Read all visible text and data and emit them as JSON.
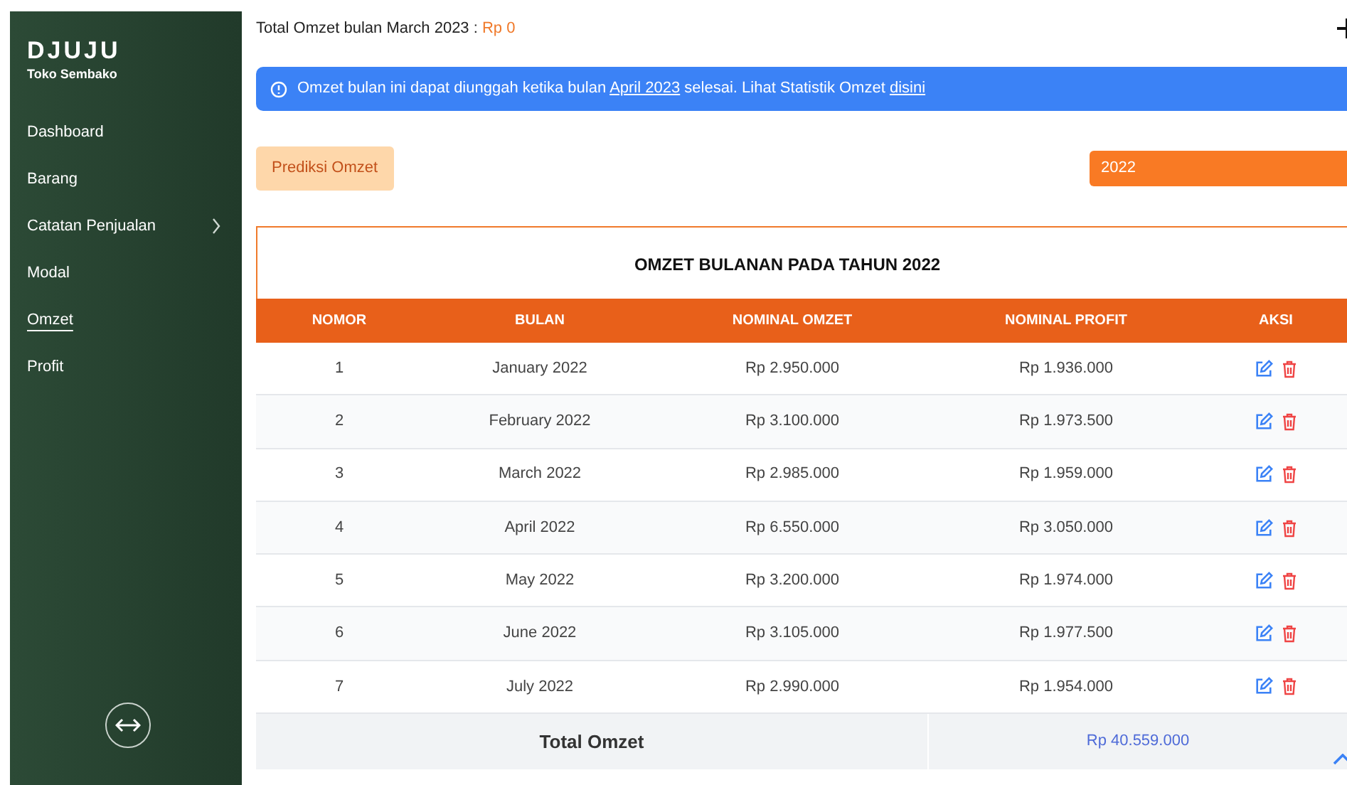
{
  "sidebar": {
    "brand": "DJUJU",
    "subtitle": "Toko Sembako",
    "items": [
      {
        "label": "Dashboard",
        "selected": false
      },
      {
        "label": "Barang",
        "selected": false
      },
      {
        "label": "Catatan Penjualan",
        "selected": false,
        "expanded": false
      },
      {
        "label": "Modal",
        "selected": false
      },
      {
        "label": "Omzet",
        "selected": true
      },
      {
        "label": "Profit",
        "selected": false
      }
    ]
  },
  "header": {
    "label": "Total Omzet bulan March 2023 :",
    "value": "Rp 0"
  },
  "alert": {
    "before": "Omzet bulan ini dapat diunggah ketika bulan",
    "link1": "April 2023",
    "middle": "selesai. Lihat Statistik Omzet",
    "link2": "disini"
  },
  "predict_button": "Prediksi Omzet",
  "year_select": {
    "value": "2022"
  },
  "table": {
    "title": "OMZET BULANAN PADA TAHUN 2022",
    "columns": [
      "NOMOR",
      "BULAN",
      "NOMINAL OMZET",
      "NOMINAL PROFIT",
      "AKSI"
    ],
    "rows": [
      [
        "1",
        "January 2022",
        "Rp 2.950.000",
        "Rp 1.936.000"
      ],
      [
        "2",
        "February 2022",
        "Rp 3.100.000",
        "Rp 1.973.500"
      ],
      [
        "3",
        "March 2022",
        "Rp 2.985.000",
        "Rp 1.959.000"
      ],
      [
        "4",
        "April 2022",
        "Rp 6.550.000",
        "Rp 3.050.000"
      ],
      [
        "5",
        "May 2022",
        "Rp 3.200.000",
        "Rp 1.974.000"
      ],
      [
        "6",
        "June 2022",
        "Rp 3.105.000",
        "Rp 1.977.500"
      ],
      [
        "7",
        "July 2022",
        "Rp 2.990.000",
        "Rp 1.954.000"
      ]
    ],
    "total_label": "Total Omzet",
    "total_value": "Rp 40.559.000"
  }
}
